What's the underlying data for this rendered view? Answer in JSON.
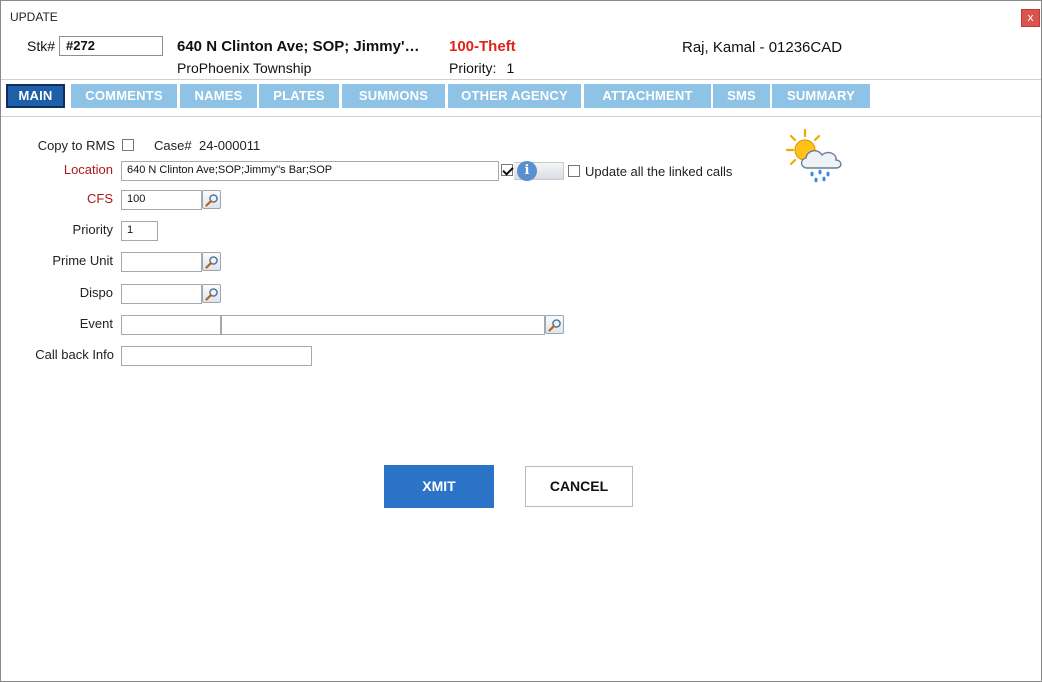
{
  "window": {
    "title": "UPDATE",
    "close_label": "x"
  },
  "header": {
    "stk_label": "Stk#",
    "stk_value": "#272",
    "address": "640 N Clinton Ave; SOP; Jimmy'…",
    "township": "ProPhoenix Township",
    "call_type": "100-Theft",
    "priority_label": "Priority:",
    "priority_value": "1",
    "officer": "Raj, Kamal - 01236CAD"
  },
  "tabs": [
    {
      "label": "MAIN",
      "active": true
    },
    {
      "label": "COMMENTS"
    },
    {
      "label": "NAMES"
    },
    {
      "label": "PLATES"
    },
    {
      "label": "SUMMONS"
    },
    {
      "label": "OTHER AGENCY"
    },
    {
      "label": "ATTACHMENT"
    },
    {
      "label": "SMS"
    },
    {
      "label": "SUMMARY"
    }
  ],
  "form": {
    "copy_to_rms_label": "Copy to RMS",
    "copy_to_rms_checked": false,
    "case_label": "Case#",
    "case_value": "24-000011",
    "location_label": "Location",
    "location_value": "640 N Clinton Ave;SOP;Jimmy''s Bar;SOP",
    "location_verified_checked": true,
    "update_linked_label": "Update all the linked calls",
    "update_linked_checked": false,
    "cfs_label": "CFS",
    "cfs_value": "100",
    "priority_label": "Priority",
    "priority_value": "1",
    "prime_unit_label": "Prime Unit",
    "prime_unit_value": "",
    "dispo_label": "Dispo",
    "dispo_value": "",
    "event_label": "Event",
    "event_code_value": "",
    "event_desc_value": "",
    "callback_label": "Call back Info",
    "callback_value": ""
  },
  "icons": {
    "info": "info-icon",
    "lookup": "magnifier-icon",
    "weather": "sun-cloud-rain-icon"
  },
  "colors": {
    "call_type": "#e0221b",
    "required_label": "#b01818",
    "tab": "#8ec3e6",
    "tab_active": "#1f5fa8",
    "primary_button": "#2a73c6"
  },
  "buttons": {
    "xmit": "XMIT",
    "cancel": "CANCEL"
  }
}
